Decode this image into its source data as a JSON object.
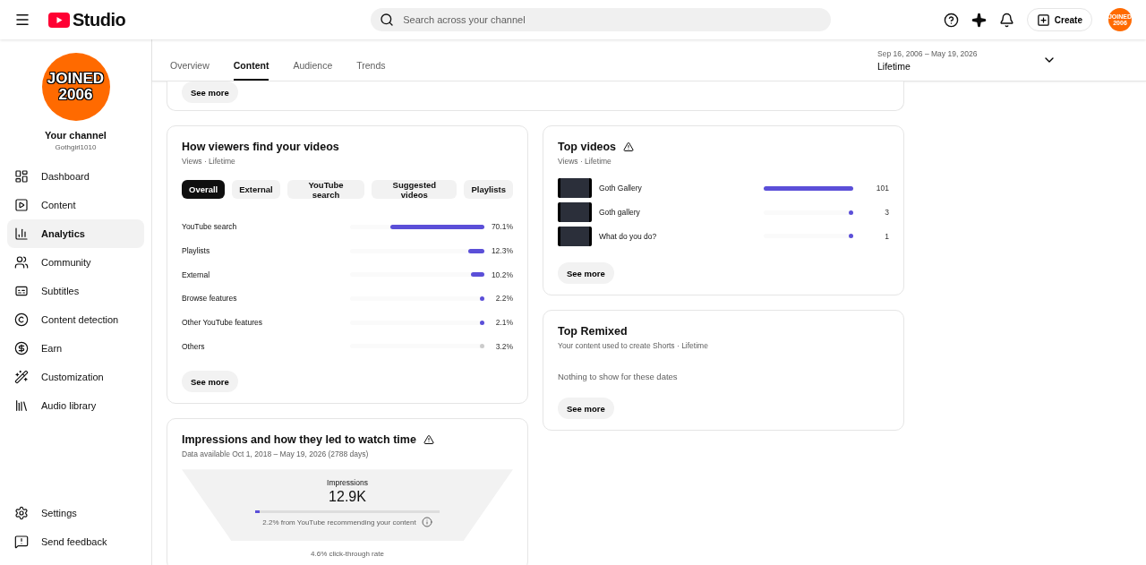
{
  "header": {
    "logo_text": "Studio",
    "search": {
      "placeholder": "Search across your channel"
    },
    "create_label": "Create",
    "avatar_text": "JOINED 2006"
  },
  "sidebar": {
    "avatar_text": [
      "JOINED",
      "2006"
    ],
    "channel_title": "Your channel",
    "channel_handle": "Gothgirl1010",
    "items": [
      {
        "label": "Dashboard",
        "selected": false
      },
      {
        "label": "Content",
        "selected": false
      },
      {
        "label": "Analytics",
        "selected": true
      },
      {
        "label": "Community",
        "selected": false
      },
      {
        "label": "Subtitles",
        "selected": false
      },
      {
        "label": "Content detection",
        "selected": false
      },
      {
        "label": "Earn",
        "selected": false
      },
      {
        "label": "Customization",
        "selected": false
      },
      {
        "label": "Audio library",
        "selected": false
      }
    ],
    "footer_items": [
      {
        "label": "Settings"
      },
      {
        "label": "Send feedback"
      }
    ]
  },
  "tabs": [
    {
      "label": "Overview",
      "selected": false
    },
    {
      "label": "Content",
      "selected": true
    },
    {
      "label": "Audience",
      "selected": false
    },
    {
      "label": "Trends",
      "selected": false
    }
  ],
  "date_range": {
    "range": "Sep 16, 2006 – May 19, 2026",
    "label": "Lifetime"
  },
  "top_card": {
    "button": "See more"
  },
  "traffic_card": {
    "title": "How viewers find your videos",
    "subtitle": "Views · Lifetime",
    "filters": [
      {
        "label": "Overall",
        "selected": true
      },
      {
        "label": "External",
        "selected": false
      },
      {
        "label": "YouTube search",
        "selected": false
      },
      {
        "label": "Suggested videos",
        "selected": false
      },
      {
        "label": "Playlists",
        "selected": false
      }
    ],
    "rows": [
      {
        "label": "YouTube search",
        "level": 0.701,
        "value": "70.1%",
        "color": "#5b4fd8"
      },
      {
        "label": "Playlists",
        "level": 0.123,
        "value": "12.3%",
        "color": "#5b4fd8"
      },
      {
        "label": "External",
        "level": 0.102,
        "value": "10.2%",
        "color": "#5b4fd8"
      },
      {
        "label": "Browse features",
        "level": 0.022,
        "value": "2.2%",
        "color": "#5b4fd8"
      },
      {
        "label": "Other YouTube features",
        "level": 0.021,
        "value": "2.1%",
        "color": "#5b4fd8"
      },
      {
        "label": "Others",
        "level": 0.032,
        "value": "3.2%",
        "color": "#cccccc"
      }
    ],
    "button": "See more"
  },
  "top_videos": {
    "title": "Top videos",
    "warning": true,
    "subtitle": "Views · Lifetime",
    "rows": [
      {
        "title": "Goth Gallery",
        "level": 1.0,
        "value": "101"
      },
      {
        "title": "Goth gallery",
        "level": 0.03,
        "value": "3"
      },
      {
        "title": "What do you do?",
        "level": 0.01,
        "value": "1"
      }
    ],
    "button": "See more"
  },
  "top_remixed": {
    "title": "Top Remixed",
    "subtitle": "Your content used to create Shorts · Lifetime",
    "empty": "Nothing to show for these dates",
    "button": "See more"
  },
  "impressions": {
    "title": "Impressions and how they led to watch time",
    "warning": true,
    "subtitle": "Data available Oct 1, 2018 – May 19, 2026 (2788 days)",
    "stage_label": "Impressions",
    "stage_value": "12.9K",
    "level": 0.022,
    "note": "2.2% from YouTube recommending your content",
    "next_label": "4.6% click-through rate"
  }
}
